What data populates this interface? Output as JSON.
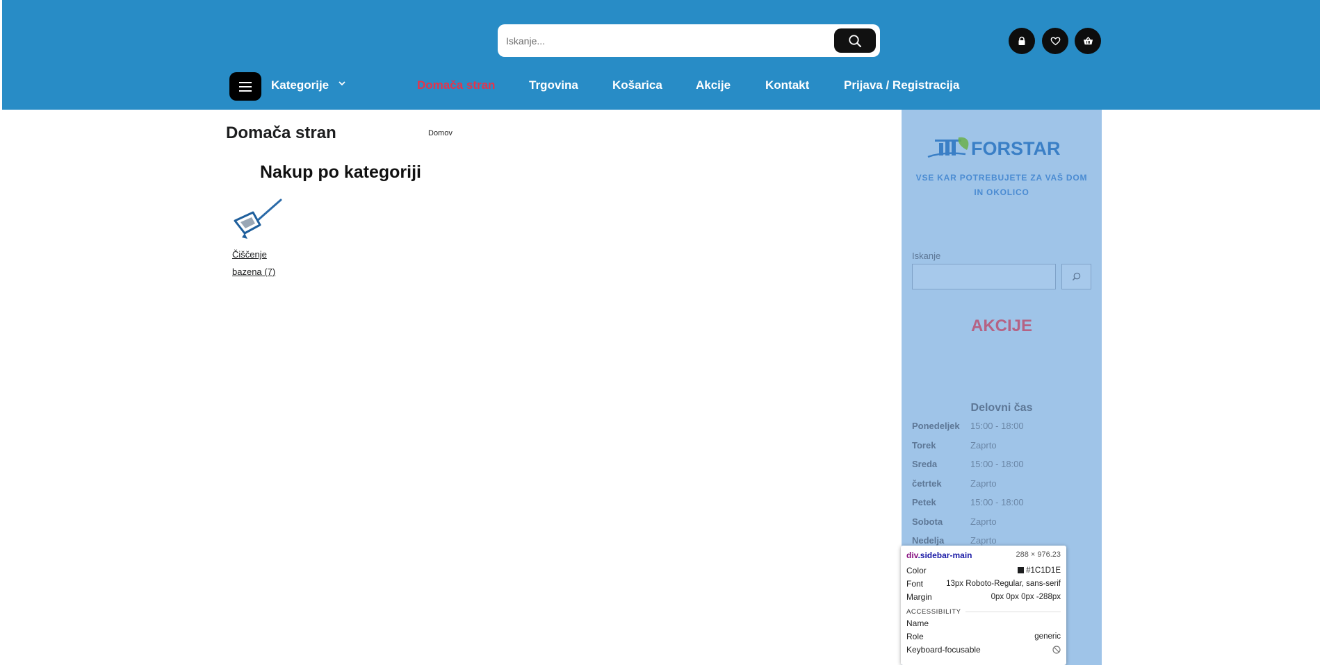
{
  "header": {
    "search_placeholder": "Iskanje...",
    "nav": {
      "categories_label": "Kategorije",
      "items": [
        "Domača stran",
        "Trgovina",
        "Košarica",
        "Akcije",
        "Kontakt",
        "Prijava / Registracija"
      ]
    }
  },
  "main": {
    "page_title": "Domača stran",
    "breadcrumb": "Domov",
    "section_title": "Nakup po kategoriji",
    "category": {
      "line1": "Čiščenje",
      "line2": "bazena (7)"
    }
  },
  "sidebar": {
    "logo_text": "FORSTAR",
    "tagline": "VSE KAR POTREBUJETE ZA VAŠ DOM IN OKOLICO",
    "search_label": "Iskanje",
    "akcije": "AKCIJE",
    "hours_title": "Delovni čas",
    "hours": [
      {
        "day": "Ponedeljek",
        "time": "15:00 - 18:00"
      },
      {
        "day": "Torek",
        "time": "Zaprto"
      },
      {
        "day": "Sreda",
        "time": "15:00 - 18:00"
      },
      {
        "day": "četrtek",
        "time": "Zaprto"
      },
      {
        "day": "Petek",
        "time": "15:00 - 18:00"
      },
      {
        "day": "Sobota",
        "time": "Zaprto"
      },
      {
        "day": "Nedelja",
        "time": "Zaprto"
      }
    ]
  },
  "inspector": {
    "element_tag": "div",
    "element_class": ".sidebar-main",
    "dimensions": "288 × 976.23",
    "color_label": "Color",
    "color_value": "#1C1D1E",
    "font_label": "Font",
    "font_value": "13px Roboto-Regular, sans-serif",
    "margin_label": "Margin",
    "margin_value": "0px 0px 0px -288px",
    "accessibility_heading": "ACCESSIBILITY",
    "name_label": "Name",
    "role_label": "Role",
    "role_value": "generic",
    "keyboard_label": "Keyboard-focusable"
  },
  "colors": {
    "header_bg": "#288cc6",
    "active_nav": "#e5334b",
    "sidebar_bg": "#9fc4e8",
    "akcije": "#b56384"
  }
}
